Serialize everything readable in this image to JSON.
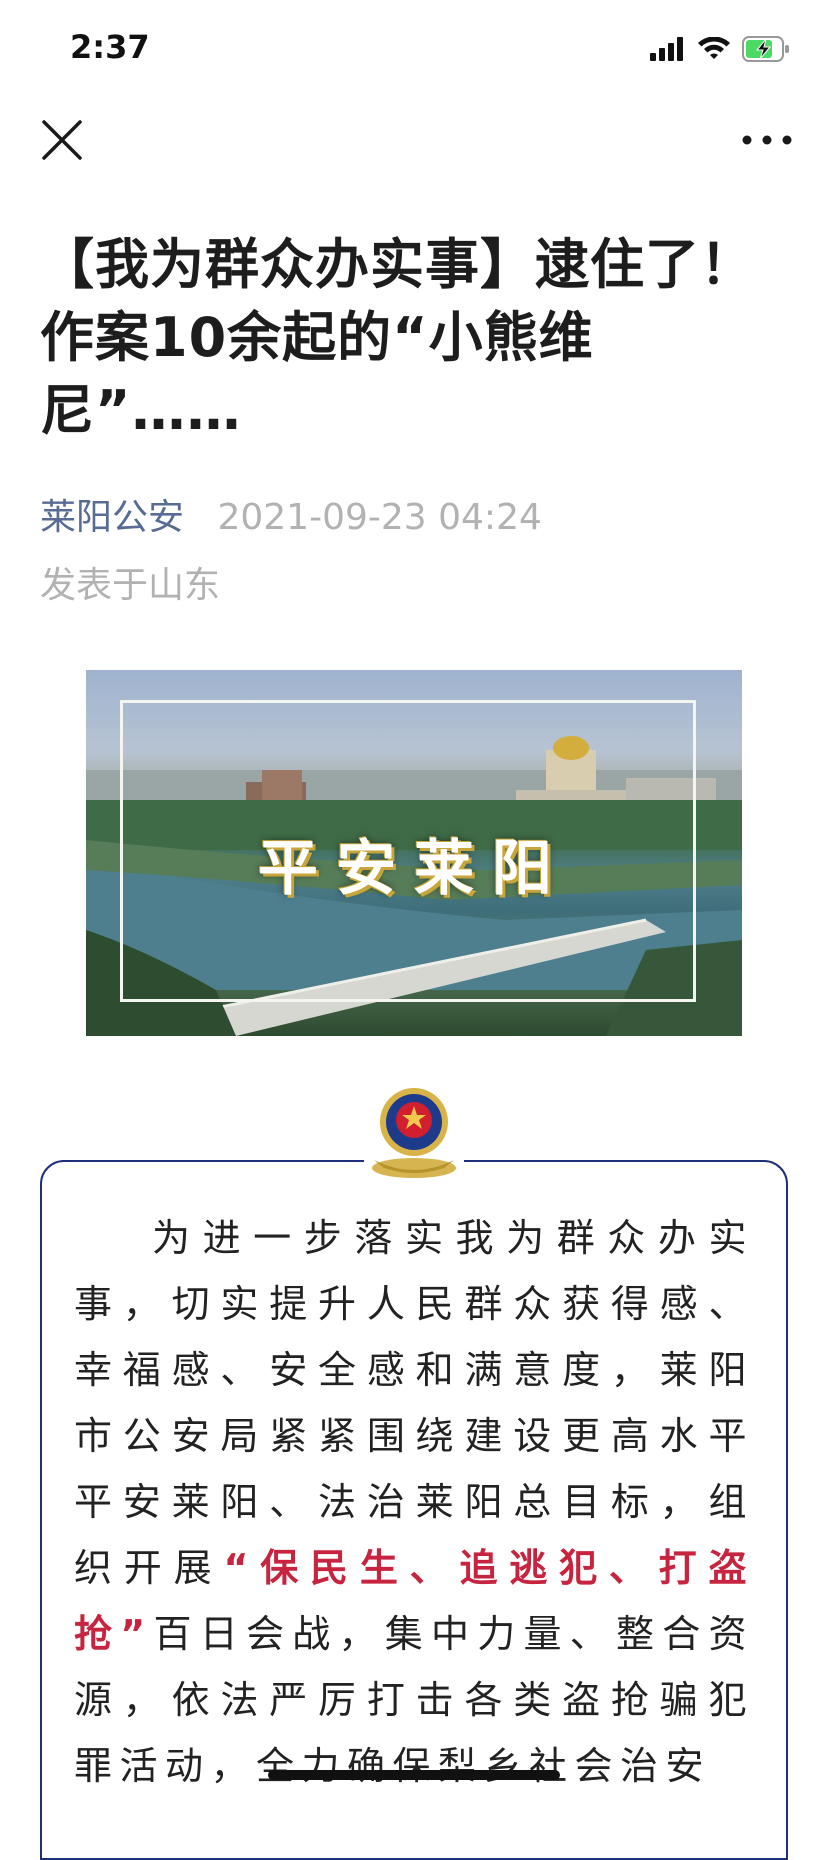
{
  "status_bar": {
    "time": "2:37",
    "icons": [
      "signal-icon",
      "wifi-icon",
      "battery-charging-icon"
    ]
  },
  "nav": {
    "close_icon": "close-icon",
    "more_icon": "more-icon"
  },
  "article": {
    "title": "【我为群众办实事】逮住了！作案10余起的“小熊维尼”……",
    "author": "莱阳公安",
    "date": "2021-09-23 04:24",
    "location": "发表于山东",
    "hero_caption": "平安莱阳",
    "body_before": "为进一步落实我为群众办实事，切实提升人民群众获得感、幸福感、安全感和满意度，莱阳市公安局紧紧围绕建设更高水平平安莱阳、法治莱阳总目标，组织开展",
    "body_highlight": "“保民生、追逃犯、打盗抢”",
    "body_after": "百日会战，集中力量、整合资源，依法严厉打击各类盗抢骗犯罪活动，全力确保梨乡社会治安"
  },
  "colors": {
    "author_link": "#576b95",
    "highlight": "#c7253f",
    "frame": "#1f2f7a"
  }
}
